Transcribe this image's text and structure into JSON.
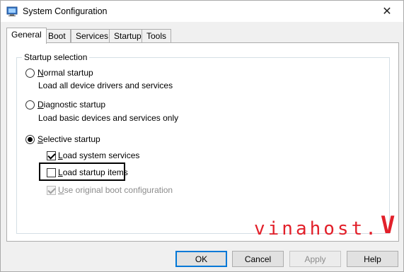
{
  "window": {
    "title": "System Configuration",
    "close_glyph": "✕"
  },
  "tabs": [
    {
      "label": "General",
      "active": true
    },
    {
      "label": "Boot",
      "active": false
    },
    {
      "label": "Services",
      "active": false
    },
    {
      "label": "Startup",
      "active": false
    },
    {
      "label": "Tools",
      "active": false
    }
  ],
  "startup": {
    "group_title": "Startup selection",
    "normal": {
      "accel": "N",
      "rest": "ormal startup",
      "desc": "Load all device drivers and services",
      "selected": false
    },
    "diagnostic": {
      "accel": "D",
      "rest": "iagnostic startup",
      "desc": "Load basic devices and services only",
      "selected": false
    },
    "selective": {
      "accel": "S",
      "rest": "elective startup",
      "selected": true
    },
    "load_system_services": {
      "accel": "L",
      "rest": "oad system services",
      "checked": true,
      "enabled": true
    },
    "load_startup_items": {
      "accel": "L",
      "rest": "oad startup items",
      "checked": false,
      "enabled": true
    },
    "use_original_boot": {
      "accel": "U",
      "rest": "se original boot configuration",
      "checked": true,
      "enabled": false
    }
  },
  "watermark": {
    "text": "vinahost.",
    "mark": "V",
    "color": "#e2202a"
  },
  "buttons": {
    "ok": "OK",
    "cancel": "Cancel",
    "apply": "Apply",
    "help": "Help"
  }
}
